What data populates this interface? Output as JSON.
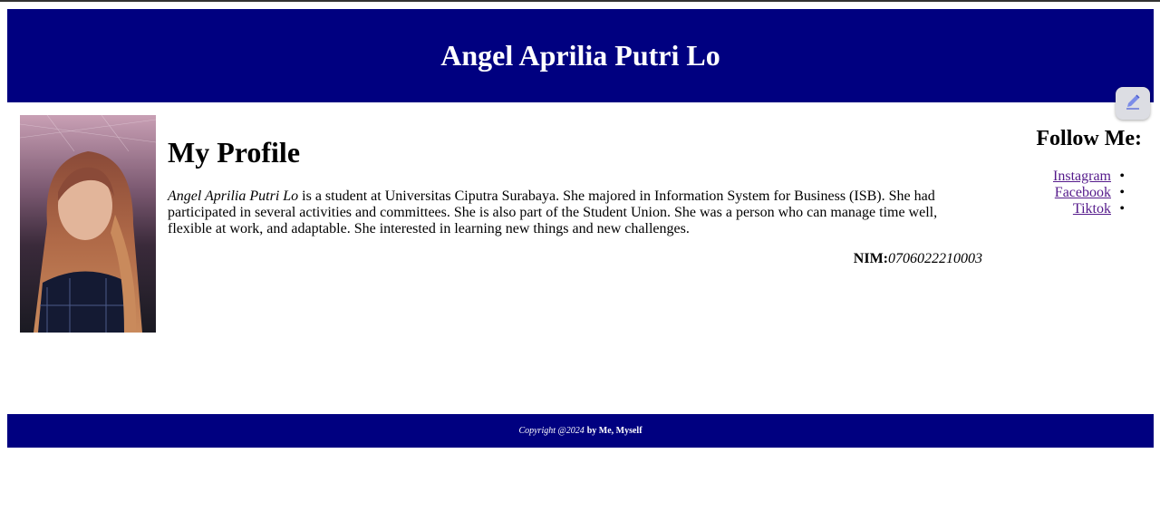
{
  "header": {
    "title": "Angel Aprilia Putri Lo"
  },
  "profile": {
    "heading": "My Profile",
    "name_italic": "Angel Aprilia Putri Lo",
    "bio": " is a student at Universitas Ciputra Surabaya. She majored in Information System for Business (ISB). She had participated in several activities and committees. She is also part of the Student Union. She was a person who can manage time well, flexible at work, and adaptable. She interested in learning new things and new challenges.",
    "nim_label": "NIM:",
    "nim_value": "0706022210003"
  },
  "follow": {
    "heading": "Follow Me:",
    "links": [
      {
        "label": "Instagram"
      },
      {
        "label": "Facebook"
      },
      {
        "label": "Tiktok"
      }
    ]
  },
  "footer": {
    "copyright": "Copyright @2024",
    "author": "by Me, Myself"
  },
  "colors": {
    "banner": "#000080",
    "visited_link": "#551a8b"
  },
  "icons": {
    "edit": "pencil-icon"
  }
}
